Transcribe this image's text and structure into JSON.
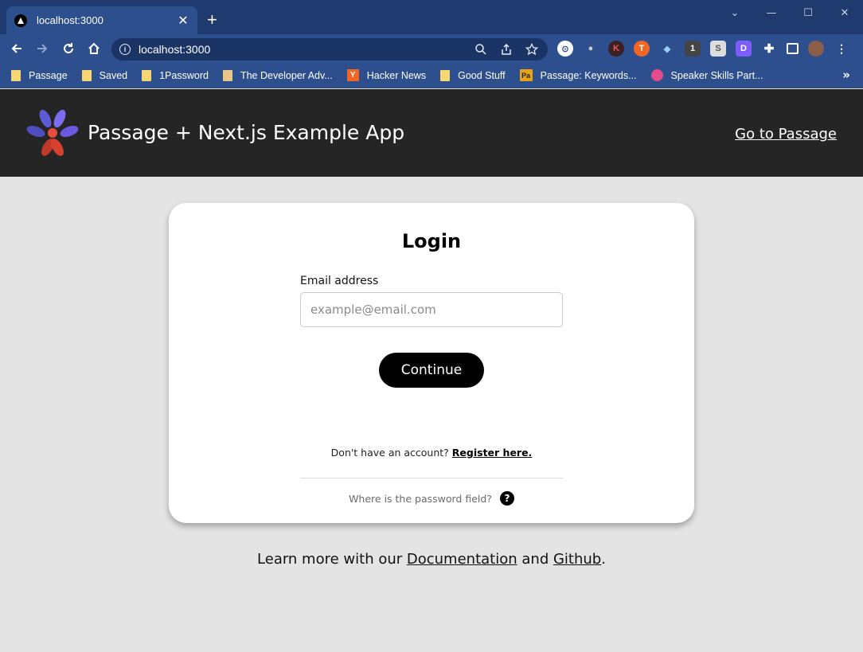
{
  "browser": {
    "tab_title": "localhost:3000",
    "tab_close": "✕",
    "new_tab": "+",
    "url": "localhost:3000",
    "window_controls": [
      "⌄",
      "—",
      "☐",
      "✕"
    ],
    "bookmarks": [
      {
        "label": "Passage",
        "icon": "folder-icon"
      },
      {
        "label": "Saved",
        "icon": "folder-icon"
      },
      {
        "label": "1Password",
        "icon": "folder-icon"
      },
      {
        "label": "The Developer Adv...",
        "icon": "page-icon"
      },
      {
        "label": "Hacker News",
        "icon": "hacker-news-icon"
      },
      {
        "label": "Good Stuff",
        "icon": "folder-icon"
      },
      {
        "label": "Passage: Keywords...",
        "icon": "passage-favicon"
      },
      {
        "label": "Speaker Skills Part...",
        "icon": "speaker-favicon"
      }
    ],
    "bookmarks_more": "»"
  },
  "header": {
    "title": "Passage + Next.js Example App",
    "link": "Go to Passage"
  },
  "login": {
    "title": "Login",
    "email_label": "Email address",
    "email_placeholder": "example@email.com",
    "continue_label": "Continue",
    "register_prompt": "Don't have an account?",
    "register_link": "Register here.",
    "password_question": "Where is the password field?",
    "help_glyph": "?"
  },
  "footer": {
    "prefix": "Learn more with our",
    "docs_link": "Documentation",
    "middle": "and",
    "github_link": "Github",
    "suffix": "."
  },
  "colors": {
    "chrome_dark": "#1f3a6e",
    "chrome": "#2d4f8e",
    "app_header": "#252525",
    "page_bg": "#e4e4e4",
    "card_bg": "#ffffff",
    "button": "#000000"
  }
}
